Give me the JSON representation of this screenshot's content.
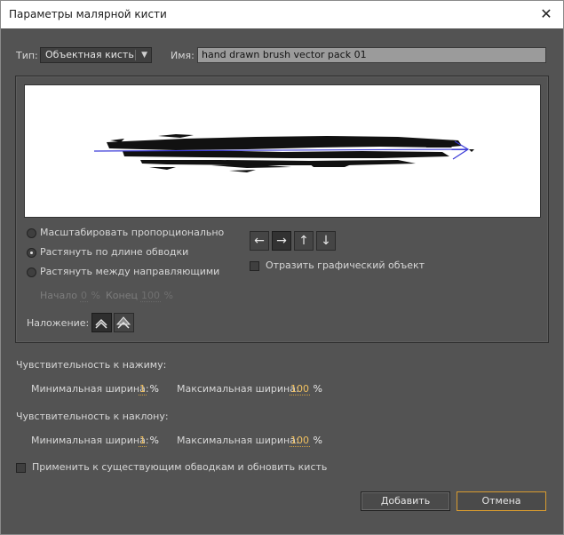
{
  "window": {
    "title": "Параметры малярной кисти",
    "close_glyph": "✕"
  },
  "type": {
    "label": "Тип:",
    "value": "Объектная кисть"
  },
  "name": {
    "label": "Имя:",
    "value": "hand drawn brush vector pack 01"
  },
  "scale_options": [
    {
      "label": "Масштабировать пропорционально",
      "selected": false
    },
    {
      "label": "Растянуть по длине обводки",
      "selected": true
    },
    {
      "label": "Растянуть между направляющими",
      "selected": false
    }
  ],
  "guides": {
    "start_label": "Начало",
    "start_value": "0",
    "start_unit": "%",
    "end_label": "Конец",
    "end_value": "100",
    "end_unit": "%"
  },
  "direction_buttons": [
    {
      "icon": "arrow-left-icon",
      "glyph": "←",
      "selected": false
    },
    {
      "icon": "arrow-right-icon",
      "glyph": "→",
      "selected": true
    },
    {
      "icon": "arrow-up-icon",
      "glyph": "↑",
      "selected": false
    },
    {
      "icon": "arrow-down-icon",
      "glyph": "↓",
      "selected": false
    }
  ],
  "flip": {
    "label": "Отразить графический объект",
    "checked": false
  },
  "overlap": {
    "label": "Наложение:"
  },
  "pressure": {
    "title": "Чувствительность к нажиму:",
    "min_label": "Минимальная ширина:",
    "min_value": "1",
    "min_unit": "%",
    "max_label": "Максимальная ширина:",
    "max_value": "100",
    "max_unit": "%"
  },
  "tilt": {
    "title": "Чувствительность к наклону:",
    "min_label": "Минимальная ширина:",
    "min_value": "1",
    "min_unit": "%",
    "max_label": "Максимальная ширина:",
    "max_value": "100",
    "max_unit": "%"
  },
  "apply": {
    "label": "Применить к существующим обводкам и обновить кисть",
    "checked": false
  },
  "buttons": {
    "add": "Добавить",
    "cancel": "Отмена"
  },
  "colors": {
    "dialog_bg": "#535353",
    "accent_orange": "#d99c2f",
    "preview_arrow": "#3a3ad8"
  }
}
